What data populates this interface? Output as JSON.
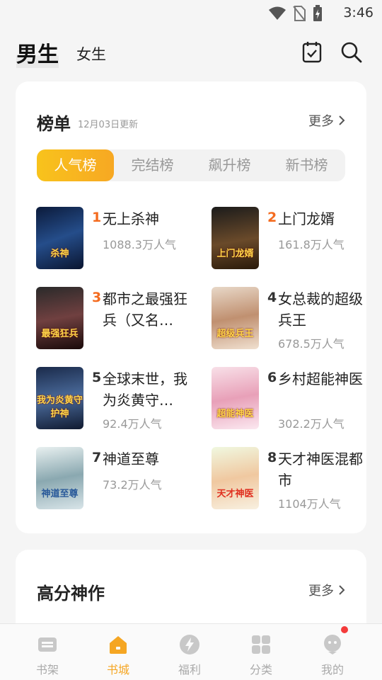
{
  "status_bar": {
    "time": "3:46"
  },
  "header": {
    "tab_male": "男生",
    "tab_female": "女生"
  },
  "ranking": {
    "title": "榜单",
    "updated": "12月03日更新",
    "more": "更多",
    "tabs": [
      "人气榜",
      "完结榜",
      "飙升榜",
      "新书榜"
    ],
    "books": [
      {
        "rank": "1",
        "title": "无上杀神",
        "popularity": "1088.3万人气",
        "cover_text": "杀神"
      },
      {
        "rank": "2",
        "title": "上门龙婿",
        "popularity": "161.8万人气",
        "cover_text": "上门龙婿"
      },
      {
        "rank": "3",
        "title": "都市之最强狂兵（又名…",
        "popularity": "",
        "cover_text": "最强狂兵"
      },
      {
        "rank": "4",
        "title": "女总裁的超级兵王",
        "popularity": "678.5万人气",
        "cover_text": "超级兵王"
      },
      {
        "rank": "5",
        "title": "全球末世，我为炎黄守…",
        "popularity": "92.4万人气",
        "cover_text": "我为炎黄守护神"
      },
      {
        "rank": "6",
        "title": "乡村超能神医",
        "popularity": "302.2万人气",
        "cover_text": "超能神医"
      },
      {
        "rank": "7",
        "title": "神道至尊",
        "popularity": "73.2万人气",
        "cover_text": "神道至尊"
      },
      {
        "rank": "8",
        "title": "天才神医混都市",
        "popularity": "1104万人气",
        "cover_text": "天才神医"
      }
    ]
  },
  "high_score": {
    "title": "高分神作",
    "more": "更多"
  },
  "tabbar": {
    "items": [
      {
        "label": "书架",
        "icon": "bookshelf-icon"
      },
      {
        "label": "书城",
        "icon": "home-icon"
      },
      {
        "label": "福利",
        "icon": "bolt-icon"
      },
      {
        "label": "分类",
        "icon": "grid-icon"
      },
      {
        "label": "我的",
        "icon": "profile-icon"
      }
    ],
    "active": "书城"
  },
  "colors": {
    "accent": "#f5a623",
    "rank_hot": "#f46b1f"
  }
}
